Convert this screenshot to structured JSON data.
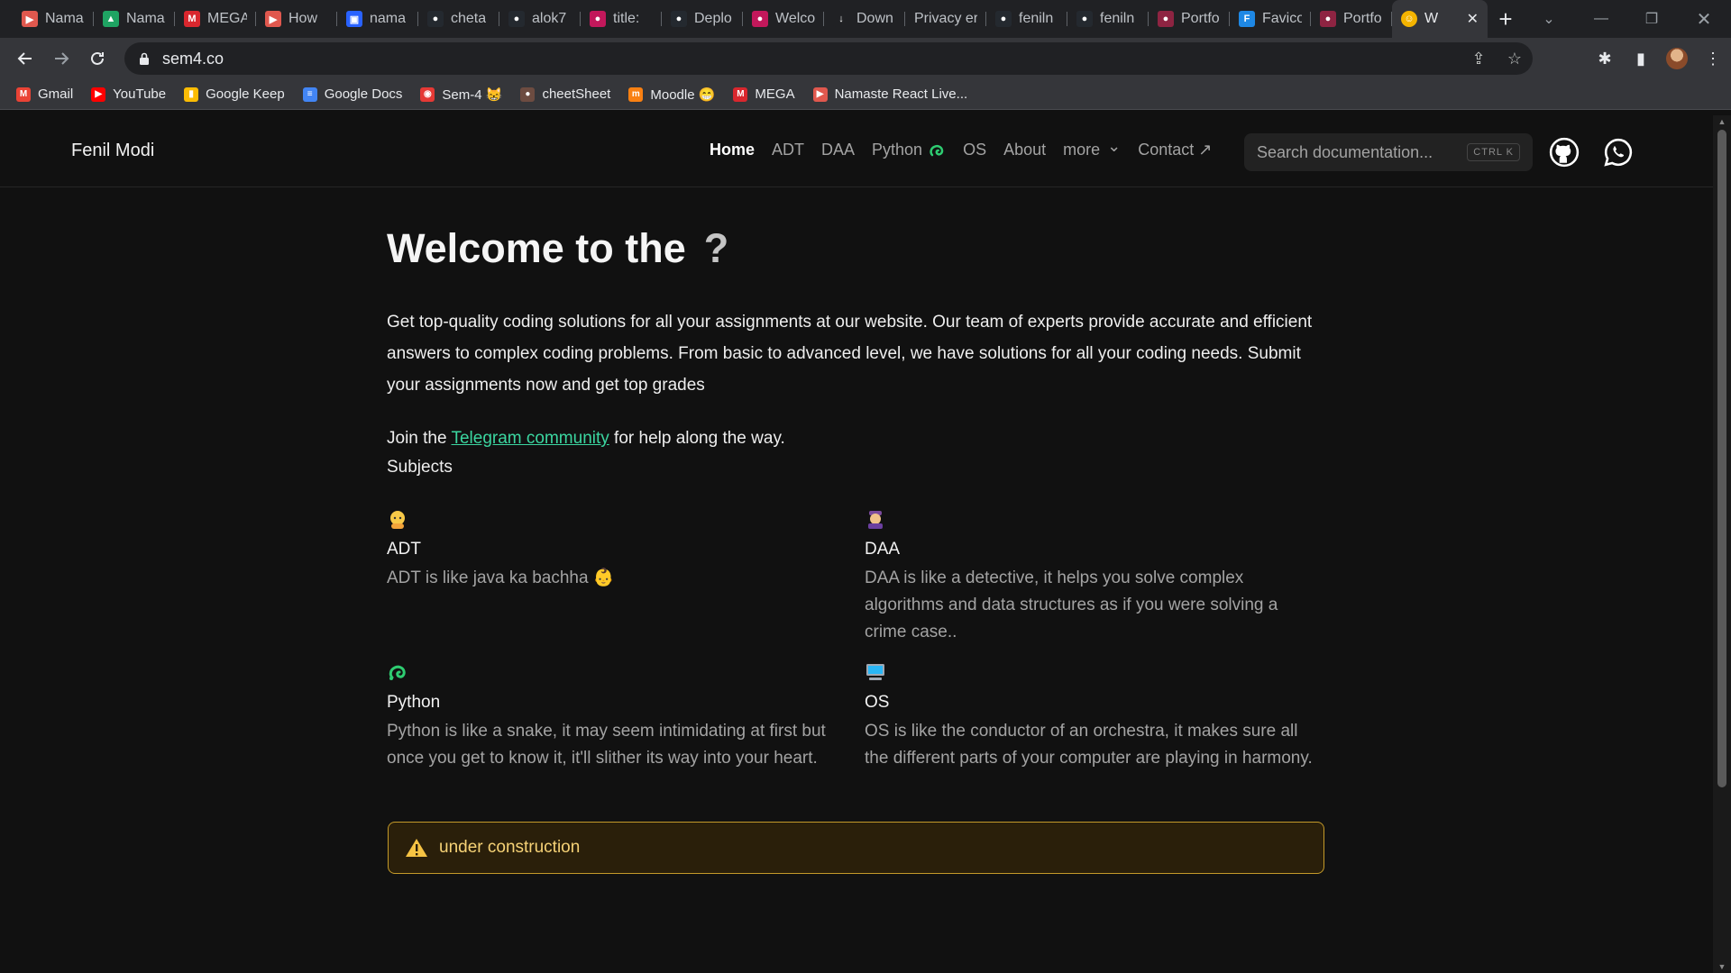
{
  "browser": {
    "tabs": [
      {
        "label": "Nama",
        "color": "#e0584e",
        "glyph": "▶"
      },
      {
        "label": "Nama",
        "color": "#1fa463",
        "glyph": "▲"
      },
      {
        "label": "MEGA",
        "color": "#d9272e",
        "glyph": "M"
      },
      {
        "label": "How",
        "color": "#e0584e",
        "glyph": "▶"
      },
      {
        "label": "nama",
        "color": "#2962ff",
        "glyph": "▣"
      },
      {
        "label": "cheta",
        "color": "#24292f",
        "glyph": "●"
      },
      {
        "label": "alok7",
        "color": "#24292f",
        "glyph": "●"
      },
      {
        "label": "title:",
        "color": "#c2185b",
        "glyph": "●"
      },
      {
        "label": "Deplo",
        "color": "#24292f",
        "glyph": "●"
      },
      {
        "label": "Welco",
        "color": "#c2185b",
        "glyph": "●"
      },
      {
        "label": "Down",
        "color": "#202124",
        "glyph": "↓"
      },
      {
        "label": "Privacy err",
        "color": "#202124",
        "glyph": ""
      },
      {
        "label": "feniln",
        "color": "#24292f",
        "glyph": "●"
      },
      {
        "label": "feniln",
        "color": "#24292f",
        "glyph": "●"
      },
      {
        "label": "Portfo",
        "color": "#8e2442",
        "glyph": "●"
      },
      {
        "label": "Favico",
        "color": "#1e88e5",
        "glyph": "F"
      },
      {
        "label": "Portfo",
        "color": "#8e2442",
        "glyph": "●"
      }
    ],
    "active_tab": {
      "label": "W",
      "close": "✕"
    },
    "new_tab": "+",
    "url": "sem4.co",
    "bookmarks": [
      {
        "label": "Gmail",
        "color": "#ea4335",
        "glyph": "M"
      },
      {
        "label": "YouTube",
        "color": "#ff0000",
        "glyph": "▶"
      },
      {
        "label": "Google Keep",
        "color": "#fbbc04",
        "glyph": "▮"
      },
      {
        "label": "Google Docs",
        "color": "#4285f4",
        "glyph": "≡"
      },
      {
        "label": "Sem-4 😸",
        "color": "#e53935",
        "glyph": "◉"
      },
      {
        "label": "cheetSheet",
        "color": "#6d4c41",
        "glyph": "●"
      },
      {
        "label": "Moodle 😁",
        "color": "#f98012",
        "glyph": "m"
      },
      {
        "label": "MEGA",
        "color": "#d9272e",
        "glyph": "M"
      },
      {
        "label": "Namaste React Live...",
        "color": "#e0584e",
        "glyph": "▶"
      }
    ]
  },
  "site": {
    "brand": "Fenil Modi",
    "nav": [
      {
        "label": "Home",
        "active": true
      },
      {
        "label": "ADT"
      },
      {
        "label": "DAA"
      },
      {
        "label": "Python"
      },
      {
        "label": "OS"
      },
      {
        "label": "About"
      },
      {
        "label": "more"
      },
      {
        "label": "Contact ↗"
      }
    ],
    "search_placeholder": "Search documentation...",
    "search_shortcut": "CTRL K"
  },
  "main": {
    "heading": "Welcome to the",
    "heading_mark": "?",
    "intro": "Get top-quality coding solutions for all your assignments at our website. Our team of experts provide accurate and efficient answers to complex coding problems. From basic to advanced level, we have solutions for all your coding needs. Submit your assignments now and get top grades",
    "join_prefix": "Join the ",
    "join_link": "Telegram community",
    "join_suffix": " for help along the way.",
    "subjects_title": "Subjects",
    "subjects": [
      {
        "title": "ADT",
        "desc": "ADT is like java ka bachha 👶",
        "icon": "baby-emoji-icon"
      },
      {
        "title": "DAA",
        "desc": "DAA is like a detective, it helps you solve complex algorithms and data structures as if you were solving a crime case..",
        "icon": "detective-emoji-icon"
      },
      {
        "title": "Python",
        "desc": "Python is like a snake, it may seem intimidating at first but once you get to know it, it'll slither its way into your heart.",
        "icon": "python-icon"
      },
      {
        "title": "OS",
        "desc": "OS is like the conductor of an orchestra, it makes sure all the different parts of your computer are playing in harmony.",
        "icon": "computer-icon"
      }
    ],
    "callout": "under construction"
  },
  "colors": {
    "accent_link": "#3bd6a0",
    "warning_border": "#c49a2a",
    "warning_text": "#f6d276"
  }
}
